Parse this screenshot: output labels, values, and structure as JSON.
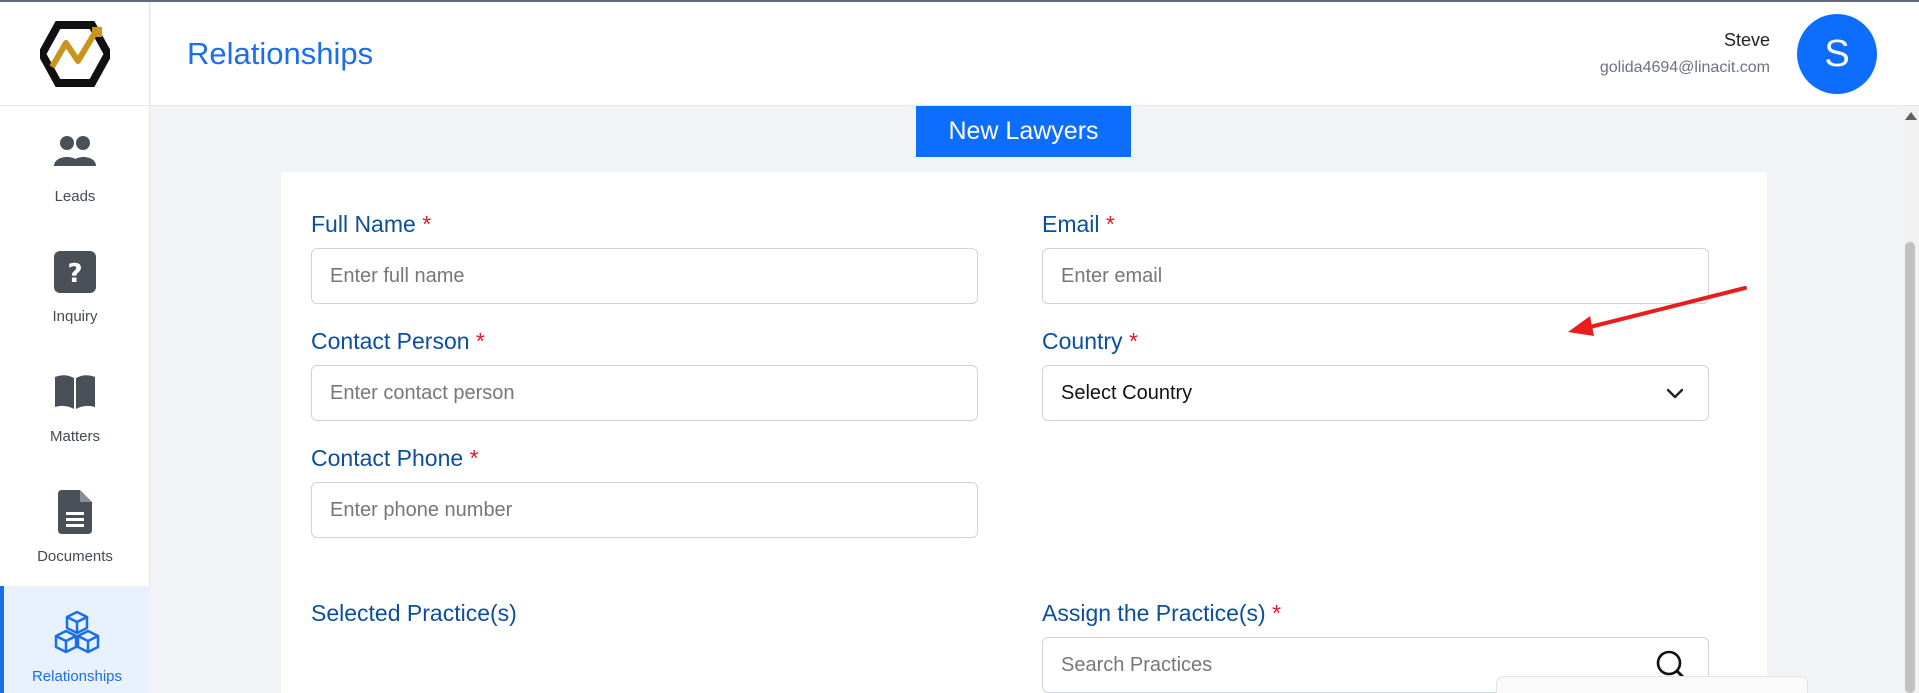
{
  "app": {
    "logo_name": "app-logo"
  },
  "sidebar": {
    "items": [
      {
        "label": "Leads",
        "icon": "users-icon"
      },
      {
        "label": "Inquiry",
        "icon": "question-icon"
      },
      {
        "label": "Matters",
        "icon": "book-icon"
      },
      {
        "label": "Documents",
        "icon": "document-icon"
      },
      {
        "label": "Relationships",
        "icon": "cubes-icon",
        "active": true
      }
    ]
  },
  "header": {
    "title": "Relationships",
    "user_name": "Steve",
    "user_email": "golida4694@linacit.com",
    "avatar_initial": "S"
  },
  "form": {
    "tab_label": "New Lawyers",
    "full_name": {
      "label": "Full Name",
      "required_mark": "*",
      "placeholder": "Enter full name",
      "value": ""
    },
    "email": {
      "label": "Email",
      "required_mark": "*",
      "placeholder": "Enter email",
      "value": ""
    },
    "contact_person": {
      "label": "Contact Person",
      "required_mark": "*",
      "placeholder": "Enter contact person",
      "value": ""
    },
    "country": {
      "label": "Country",
      "required_mark": "*",
      "selected": "Select Country"
    },
    "contact_phone": {
      "label": "Contact Phone",
      "required_mark": "*",
      "placeholder": "Enter phone number",
      "value": ""
    },
    "selected_practices": {
      "label": "Selected Practice(s)"
    },
    "assign_practices": {
      "label": "Assign the Practice(s)",
      "required_mark": "*",
      "placeholder": "Search Practices",
      "value": ""
    }
  },
  "colors": {
    "accent": "#0d6efd",
    "label": "#0b4f9c",
    "required": "#e0182d",
    "annotation_arrow": "#e81e1e"
  }
}
